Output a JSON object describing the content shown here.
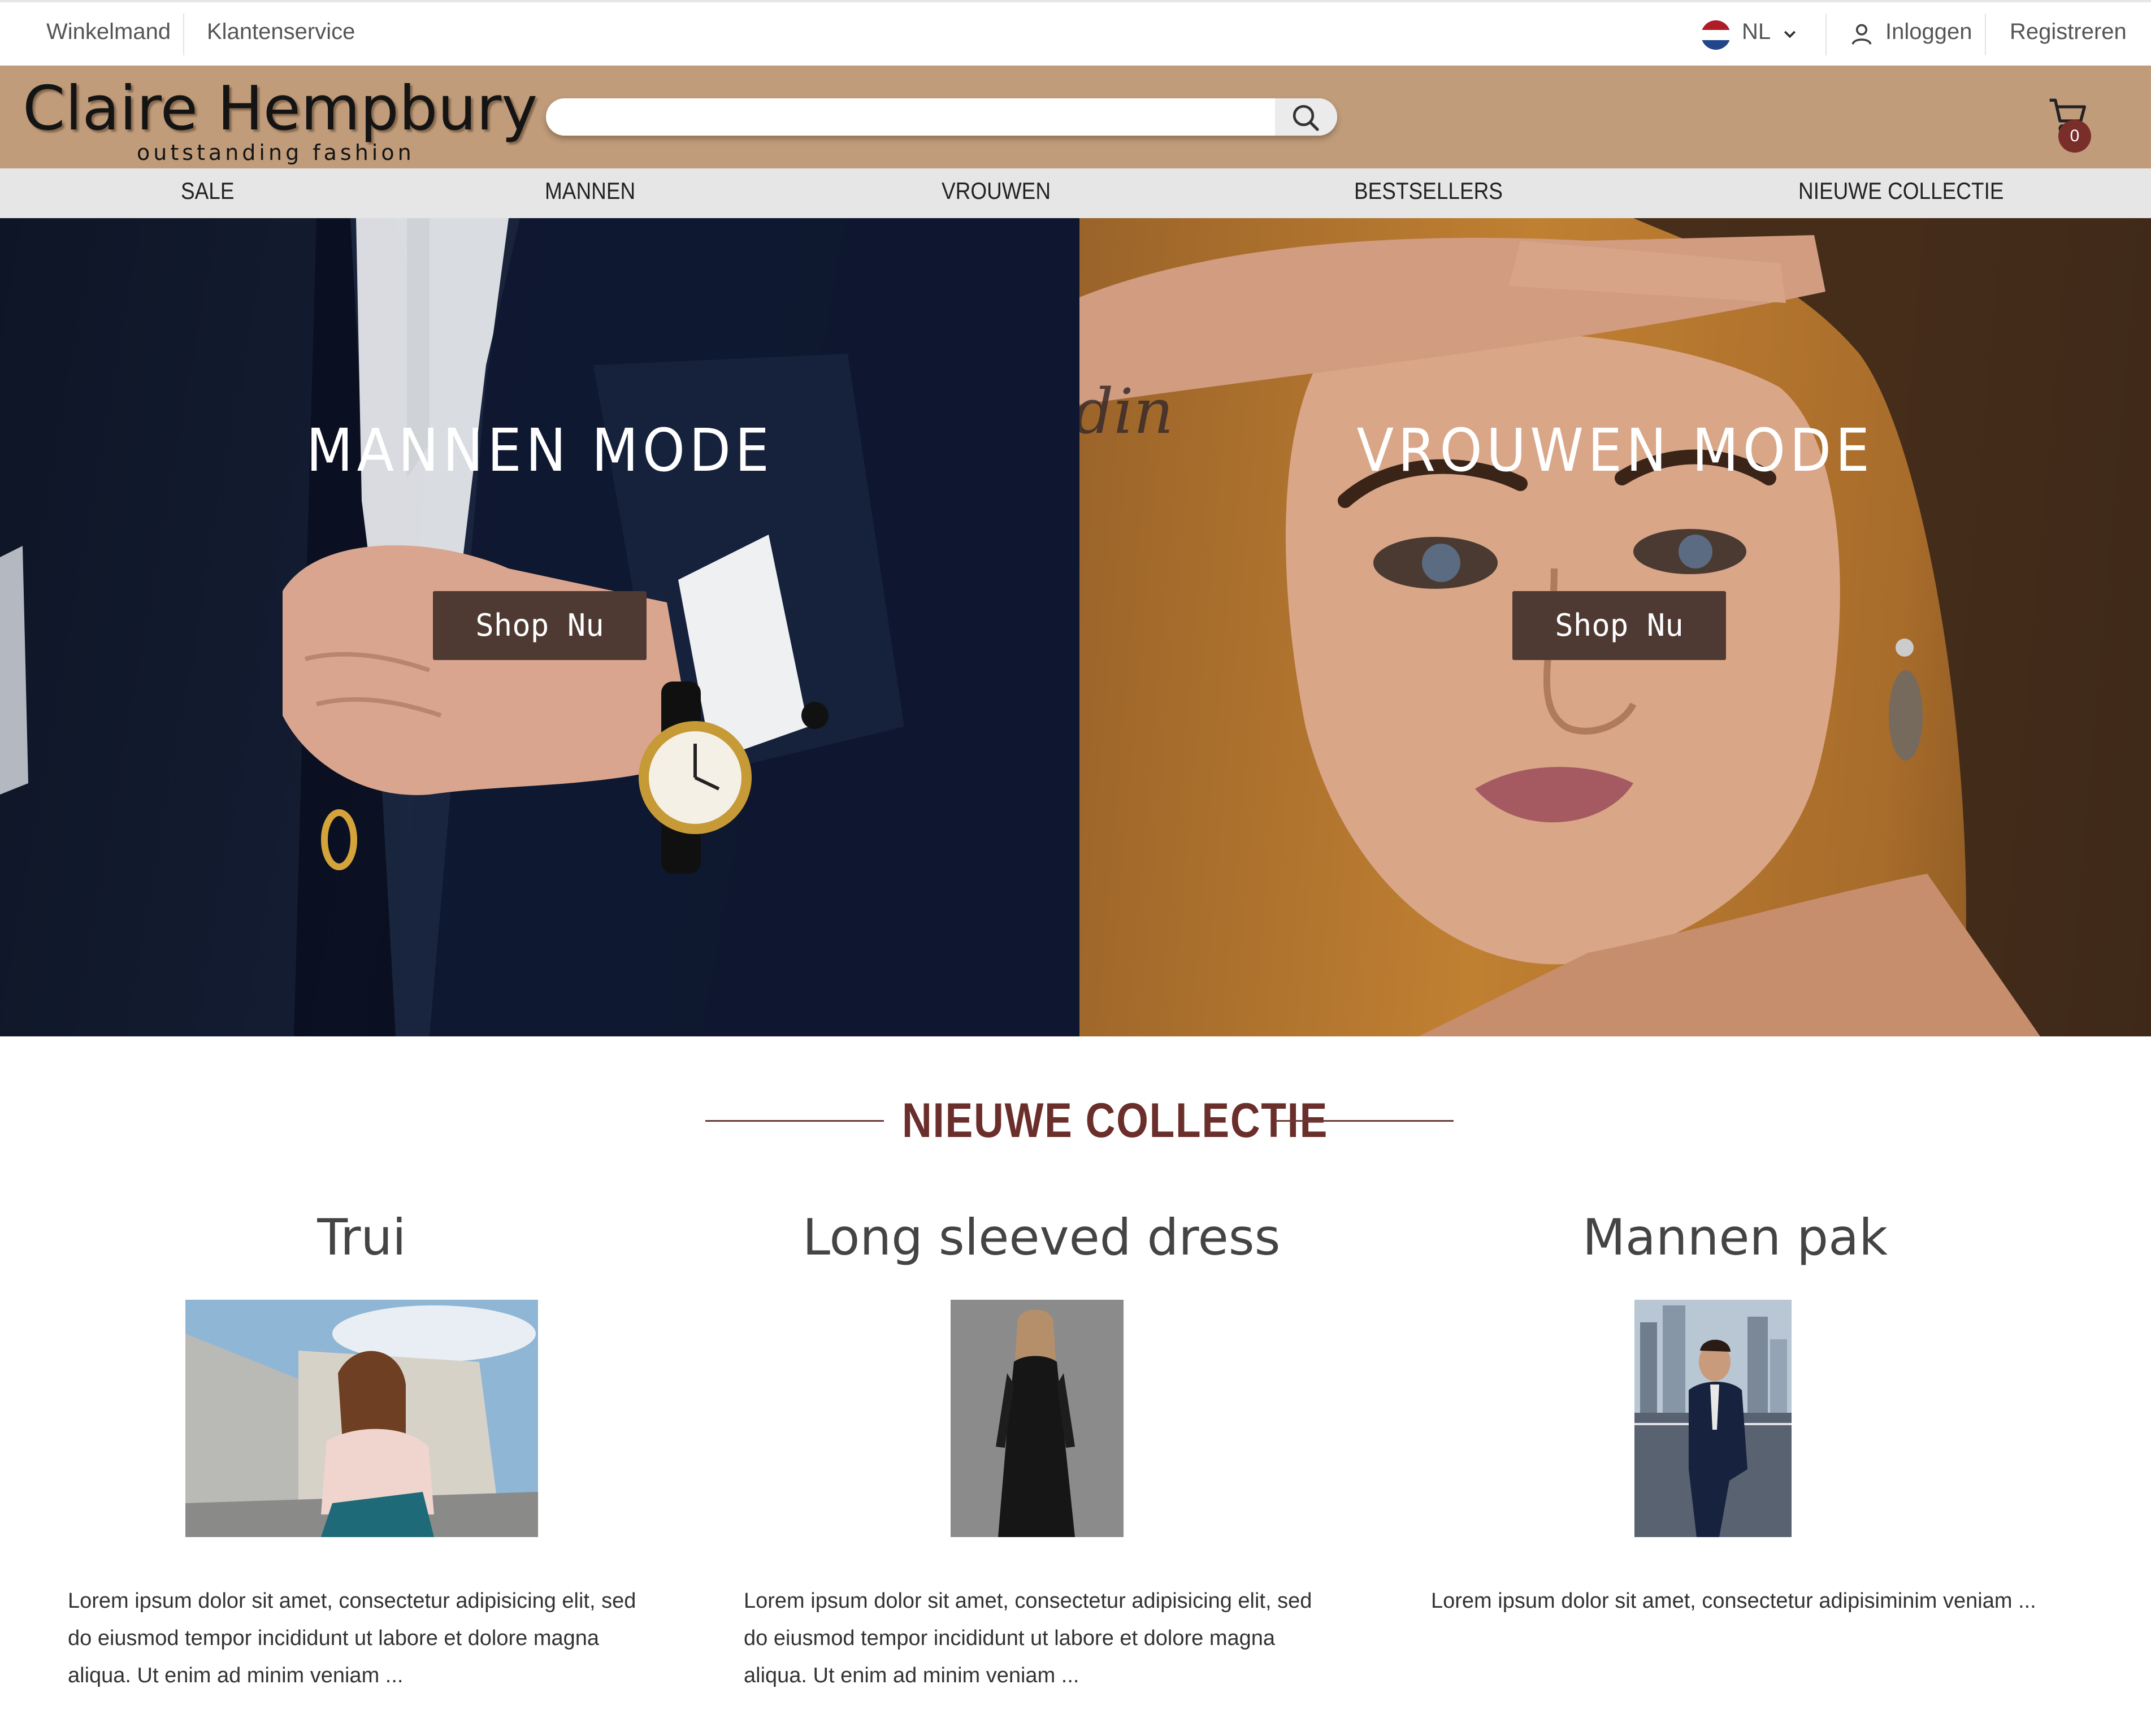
{
  "utility": {
    "cart_link": "Winkelmand",
    "service_link": "Klantenservice",
    "language": "NL",
    "login": "Inloggen",
    "register": "Registreren"
  },
  "header": {
    "logo_name": "Claire Hempbury",
    "logo_tagline": "outstanding fashion",
    "search_placeholder": "",
    "cart_count": "0"
  },
  "nav": {
    "items": [
      "SALE",
      "MANNEN",
      "VROUWEN",
      "BESTSELLERS",
      "NIEUWE COLLECTIE"
    ]
  },
  "hero": {
    "men": {
      "title": "MANNEN MODE",
      "button": "Shop Nu"
    },
    "women": {
      "title": "VROUWEN MODE",
      "button": "Shop Nu"
    }
  },
  "collection": {
    "heading": "NIEUWE COLLECTIE",
    "products": [
      {
        "title": "Trui",
        "description": "Lorem ipsum dolor sit amet, consectetur adipisicing elit, sed do eiusmod tempor incididunt ut labore et dolore magna aliqua. Ut enim ad minim veniam ..."
      },
      {
        "title": "Long sleeved dress",
        "description": "Lorem ipsum dolor sit amet, consectetur adipisicing elit, sed do eiusmod tempor incididunt ut labore et dolore magna aliqua. Ut enim ad minim veniam ..."
      },
      {
        "title": "Mannen pak",
        "description": "Lorem ipsum dolor sit amet, consectetur adipisiminim veniam ..."
      }
    ]
  },
  "colors": {
    "header_band": "#c09c7b",
    "nav_band": "#e6e6e6",
    "button": "#4e3a33",
    "heading": "#6b2f2b",
    "badge": "#7a2e2a"
  }
}
